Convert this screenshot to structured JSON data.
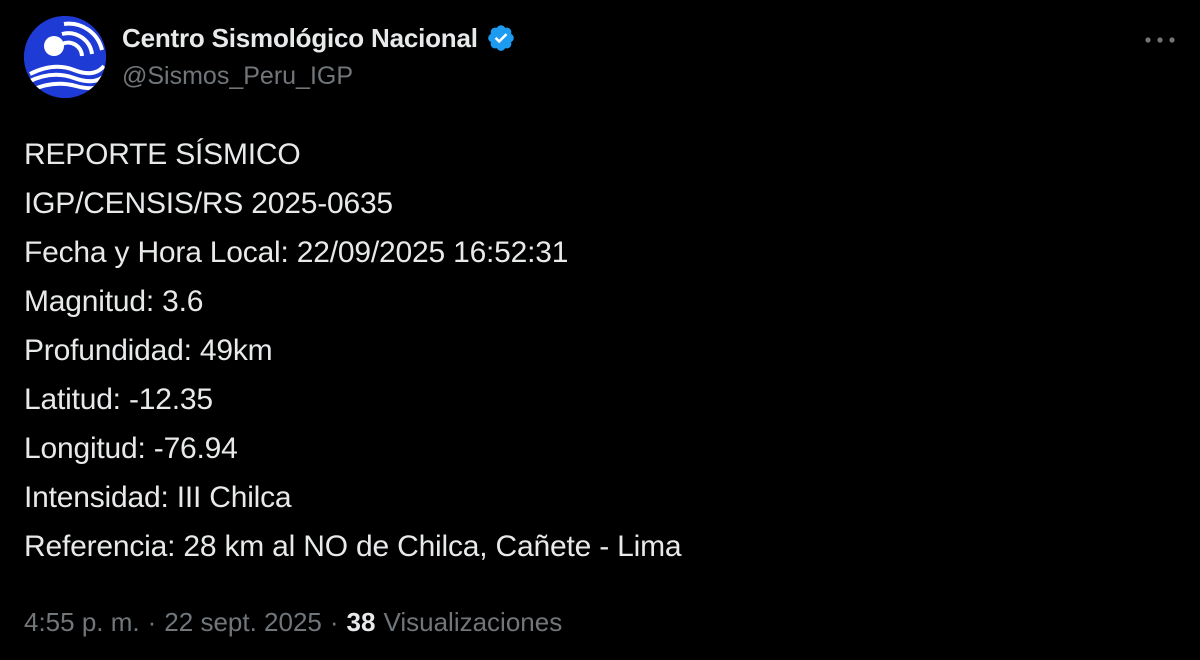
{
  "author": {
    "display_name": "Centro Sismológico Nacional",
    "handle": "@Sismos_Peru_IGP",
    "avatar_icon": "igp-logo-icon",
    "verified_icon": "verified-badge-icon",
    "verified_color": "#1d9bf0"
  },
  "tweet": {
    "lines": [
      "REPORTE SÍSMICO",
      "IGP/CENSIS/RS 2025-0635",
      "Fecha y Hora Local: 22/09/2025 16:52:31",
      "Magnitud: 3.6",
      "Profundidad: 49km",
      "Latitud: -12.35",
      "Longitud: -76.94",
      "Intensidad: III Chilca",
      "Referencia: 28 km al NO de Chilca, Cañete - Lima"
    ]
  },
  "meta": {
    "time": "4:55 p. m.",
    "separator": "·",
    "date": "22 sept. 2025",
    "views_count": "38",
    "views_label": "Visualizaciones"
  },
  "more_icon": "more-options-icon",
  "colors": {
    "background": "#000000",
    "text_primary": "#e7e9ea",
    "text_secondary": "#71767b",
    "avatar_blue": "#1f3bd6"
  }
}
